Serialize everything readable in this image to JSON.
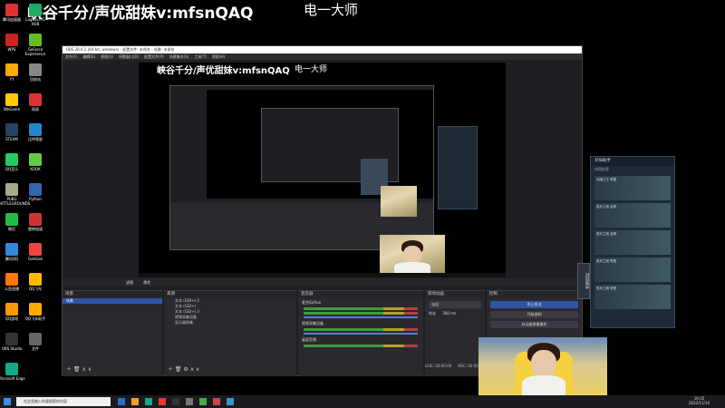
{
  "overlay": {
    "title": "峡谷千分/声优甜妹v:mfsnQAQ",
    "subtitle": "电一大师"
  },
  "desktop_icons": [
    {
      "label": "腾讯加速器",
      "color": "#d33"
    },
    {
      "label": "Logitech G HUB",
      "color": "#2a6"
    },
    {
      "label": "WPS",
      "color": "#c22"
    },
    {
      "label": "GeForce Experience",
      "color": "#6b2"
    },
    {
      "label": "YY",
      "color": "#fa0"
    },
    {
      "label": "回收站",
      "color": "#888"
    },
    {
      "label": "WeGame",
      "color": "#fc0"
    },
    {
      "label": "网易",
      "color": "#d33"
    },
    {
      "label": "STEAM",
      "color": "#246"
    },
    {
      "label": "比特彗星",
      "color": "#28c"
    },
    {
      "label": "QQ音乐",
      "color": "#2c6"
    },
    {
      "label": "KOOK",
      "color": "#6c4"
    },
    {
      "label": "PUBG BATTLEGROUNDS",
      "color": "#aa8"
    },
    {
      "label": "Python",
      "color": "#36a"
    },
    {
      "label": "微信",
      "color": "#2b4"
    },
    {
      "label": "雷神加速",
      "color": "#c33"
    },
    {
      "label": "腾讯QQ",
      "color": "#38d"
    },
    {
      "label": "GeeGee",
      "color": "#e44"
    },
    {
      "label": "斗鱼直播",
      "color": "#f70"
    },
    {
      "label": "QQ飞车",
      "color": "#fb0"
    },
    {
      "label": "QQ游戏",
      "color": "#f90"
    },
    {
      "label": "QQ飞车助手",
      "color": "#fa0"
    },
    {
      "label": "OBS Studio",
      "color": "#333"
    },
    {
      "label": "文件",
      "color": "#666"
    },
    {
      "label": "Microsoft Edge",
      "color": "#1a8"
    }
  ],
  "obs": {
    "title": "OBS 28.0.1 (64-bit, windows) - 配置文件: 未命名 - 场景: 未命名",
    "menu": [
      "文件(F)",
      "编辑(E)",
      "视图(V)",
      "停靠窗口(D)",
      "配置文件(P)",
      "场景集合(S)",
      "工具(T)",
      "帮助(H)"
    ],
    "scene_filter_bar": {
      "filter": "滤镜",
      "properties": "属性"
    },
    "scenes": {
      "header": "场景",
      "items": [
        "场景"
      ]
    },
    "sources": {
      "header": "来源",
      "items": [
        "文本 (GDI+) 2",
        "文本 (GDI+)",
        "文本 (GDI+) 3",
        "视频采集设备",
        "显示器采集"
      ]
    },
    "mixer": {
      "header": "混音器",
      "channels": [
        {
          "name": "麦克风/Aux",
          "db": "0.0 dB"
        },
        {
          "name": "视频采集设备",
          "db": "0.0 dB"
        },
        {
          "name": "桌面音频",
          "db": "0.0 dB"
        }
      ]
    },
    "transitions": {
      "header": "转场动画",
      "type": "淡出",
      "duration_label": "时长",
      "duration": "300 ms"
    },
    "controls": {
      "header": "控制",
      "start_stream": "停止推流",
      "start_record": "开始录制",
      "virtual_cam": "启动虚拟摄像机"
    },
    "status": {
      "live": "LIVE: 00:00:00",
      "rec": "REC: 00:00:00"
    }
  },
  "helper": {
    "title": "对局助手",
    "tab": "对局信息",
    "items": [
      "克隆之王 联盟",
      "胜利之路 金牌",
      "胜利之路 金牌",
      "胜利之路 联盟",
      "胜利之路 联盟"
    ],
    "side_tab": "对局助手"
  },
  "taskbar": {
    "search_placeholder": "在这里输入你要搜索的内容",
    "time": "16:05",
    "date": "2022/11/16"
  }
}
